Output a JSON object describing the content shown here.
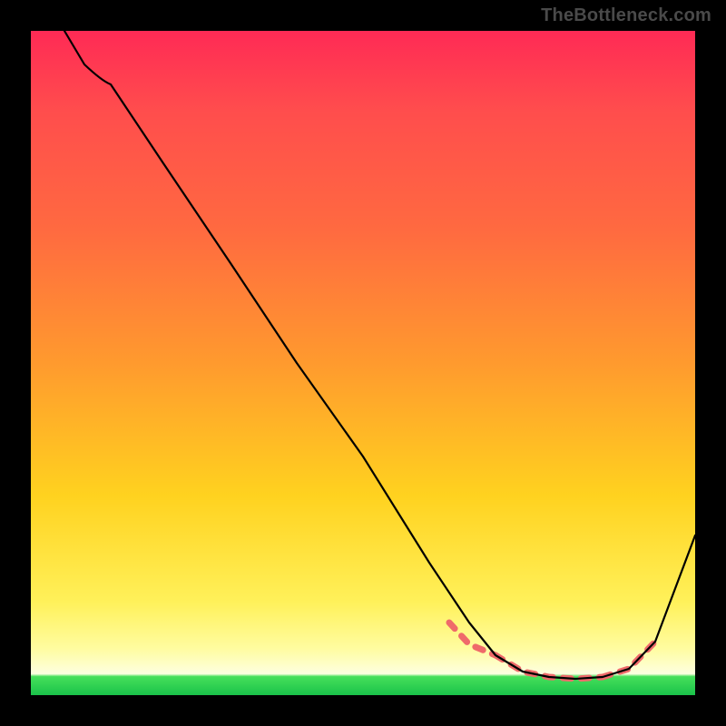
{
  "watermark": "TheBottleneck.com",
  "colors": {
    "salmon": "#ef6a6a",
    "curve": "#000000"
  },
  "chart_data": {
    "type": "line",
    "title": "",
    "xlabel": "",
    "ylabel": "",
    "xlim": [
      0,
      100
    ],
    "ylim": [
      0,
      100
    ],
    "note": "Axes and units are not rendered in the source image; values are estimated positions on a 0–100 normalized square reading left→right for x and bottom→top for y.",
    "series": [
      {
        "name": "curve",
        "x": [
          5,
          8,
          12,
          20,
          30,
          40,
          50,
          60,
          66,
          70,
          74,
          78,
          82,
          86,
          90,
          94,
          100
        ],
        "y": [
          100,
          95,
          92,
          80,
          65,
          50,
          36,
          20,
          11,
          6,
          3.5,
          2.8,
          2.5,
          2.8,
          4,
          8,
          24
        ]
      }
    ],
    "highlight_range_x": [
      63,
      90
    ],
    "highlight_style": "salmon dotted along curve near trough"
  }
}
